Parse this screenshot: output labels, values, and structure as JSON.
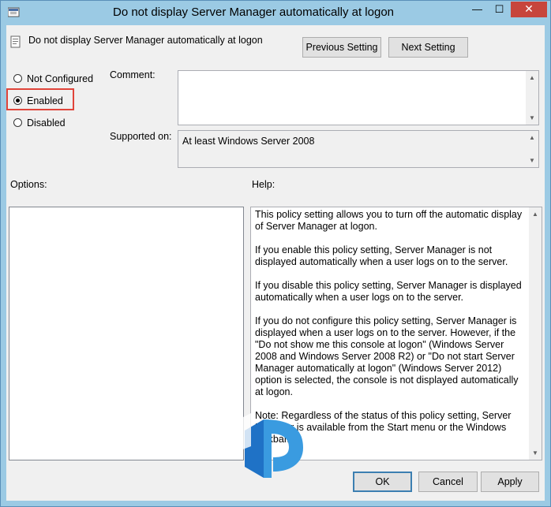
{
  "window": {
    "title": "Do not display Server Manager automatically at logon",
    "controls": {
      "minimize": "—",
      "maximize": "☐",
      "close": "✕"
    }
  },
  "header": {
    "policy_name": "Do not display Server Manager automatically at logon",
    "previous_label": "Previous Setting",
    "next_label": "Next Setting"
  },
  "state": {
    "options": [
      {
        "label": "Not Configured",
        "checked": false
      },
      {
        "label": "Enabled",
        "checked": true
      },
      {
        "label": "Disabled",
        "checked": false
      }
    ]
  },
  "comment": {
    "label": "Comment:",
    "value": ""
  },
  "supported": {
    "label": "Supported on:",
    "value": "At least Windows Server 2008"
  },
  "options_label": "Options:",
  "help": {
    "label": "Help:",
    "paragraphs": [
      "This policy setting allows you to turn off the automatic display of Server Manager at logon.",
      "If you enable this policy setting, Server Manager is not displayed automatically when a user logs on to the server.",
      "If you disable this policy setting, Server Manager is displayed automatically when a user logs on to the server.",
      "If you do not configure this policy setting, Server Manager is displayed when a user logs on to the server. However, if the \"Do not show me this console at logon\" (Windows Server 2008 and Windows Server 2008 R2) or \"Do not start Server Manager automatically at logon\" (Windows Server 2012) option is selected, the console is not displayed automatically at logon.",
      "Note: Regardless of the status of this policy setting, Server Manager is available from the Start menu or the Windows taskbar."
    ]
  },
  "footer": {
    "ok_label": "OK",
    "cancel_label": "Cancel",
    "apply_label": "Apply"
  },
  "colors": {
    "accent": "#3c7fb1",
    "highlight": "#e0443a",
    "title_bg": "#9bcae4"
  },
  "icons": {
    "app": "policy-editor-icon",
    "watermark": "prajwal-logo-icon"
  }
}
